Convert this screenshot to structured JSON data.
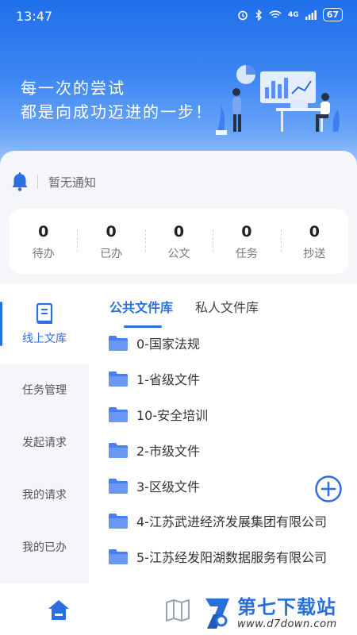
{
  "status_bar": {
    "time": "13:47",
    "battery": "67",
    "signal_text": "4G"
  },
  "banner": {
    "line1": "每一次的尝试",
    "line2": "都是向成功迈进的一步！"
  },
  "notice": {
    "text": "暂无通知"
  },
  "stats": [
    {
      "count": "0",
      "label": "待办"
    },
    {
      "count": "0",
      "label": "已办"
    },
    {
      "count": "0",
      "label": "公文"
    },
    {
      "count": "0",
      "label": "任务"
    },
    {
      "count": "0",
      "label": "抄送"
    }
  ],
  "sidebar": {
    "items": [
      {
        "label": "线上文库",
        "active": true
      },
      {
        "label": "任务管理"
      },
      {
        "label": "发起请求"
      },
      {
        "label": "我的请求"
      },
      {
        "label": "我的已办"
      }
    ]
  },
  "tabs": [
    {
      "label": "公共文件库",
      "active": true
    },
    {
      "label": "私人文件库"
    }
  ],
  "files": [
    "0-国家法规",
    "1-省级文件",
    "10-安全培训",
    "2-市级文件",
    "3-区级文件",
    "4-江苏武进经济发展集团有限公司",
    "5-江苏经发阳湖数据服务有限公司"
  ],
  "watermark": {
    "title": "第七下载站",
    "url": "www.d7down.com"
  },
  "colors": {
    "primary": "#2e6fe0",
    "header_top": "#1f6fea",
    "folder": "#4a7ff0"
  },
  "icons": {
    "notice": "bell-icon",
    "library": "book-icon",
    "folder": "folder-icon",
    "add": "plus-circle-icon",
    "home": "home-icon",
    "map": "map-book-icon"
  }
}
